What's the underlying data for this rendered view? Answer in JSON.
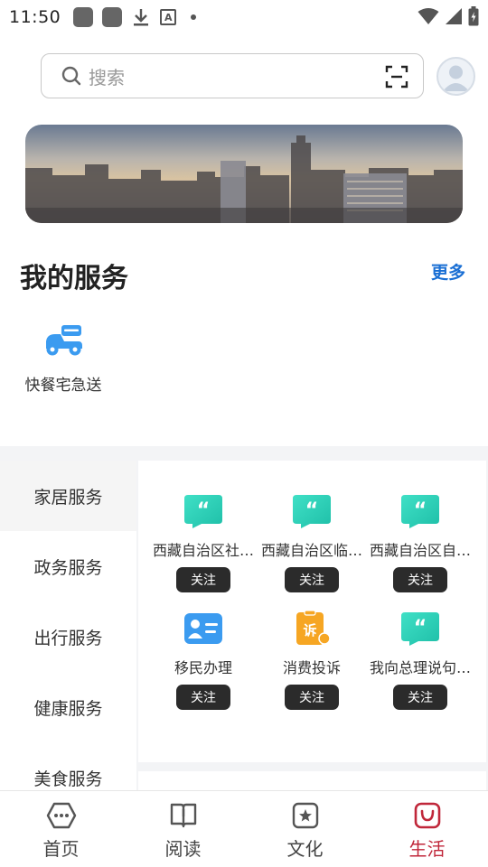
{
  "status_bar": {
    "time": "11:50"
  },
  "search": {
    "placeholder": "搜索"
  },
  "my_services": {
    "title": "我的服务",
    "more": "更多",
    "items": [
      {
        "label": "快餐宅急送",
        "icon": "scooter-icon"
      }
    ]
  },
  "categories": [
    {
      "label": "家居服务",
      "active": false
    },
    {
      "label": "政务服务",
      "active": true
    },
    {
      "label": "出行服务",
      "active": false
    },
    {
      "label": "健康服务",
      "active": false
    },
    {
      "label": "美食服务",
      "active": false
    }
  ],
  "services": [
    {
      "name": "西藏自治区社…",
      "icon": "quote-icon",
      "follow": "关注"
    },
    {
      "name": "西藏自治区临…",
      "icon": "quote-icon",
      "follow": "关注"
    },
    {
      "name": "西藏自治区自…",
      "icon": "quote-icon",
      "follow": "关注"
    },
    {
      "name": "移民办理",
      "icon": "id-card-icon",
      "follow": "关注"
    },
    {
      "name": "消费投诉",
      "icon": "complaint-icon",
      "follow": "关注"
    },
    {
      "name": "我向总理说句…",
      "icon": "quote-icon",
      "follow": "关注"
    }
  ],
  "complaint_icon_text": "诉",
  "bottom_nav": [
    {
      "label": "首页",
      "icon": "home-icon",
      "active": false
    },
    {
      "label": "阅读",
      "icon": "book-icon",
      "active": false
    },
    {
      "label": "文化",
      "icon": "star-badge-icon",
      "active": false
    },
    {
      "label": "生活",
      "icon": "bag-icon",
      "active": true
    }
  ],
  "colors": {
    "accent_blue": "#1a6fd4",
    "teal": "#2ed1b8",
    "active_nav": "#c0273a",
    "follow_button": "#2b2b2b"
  }
}
